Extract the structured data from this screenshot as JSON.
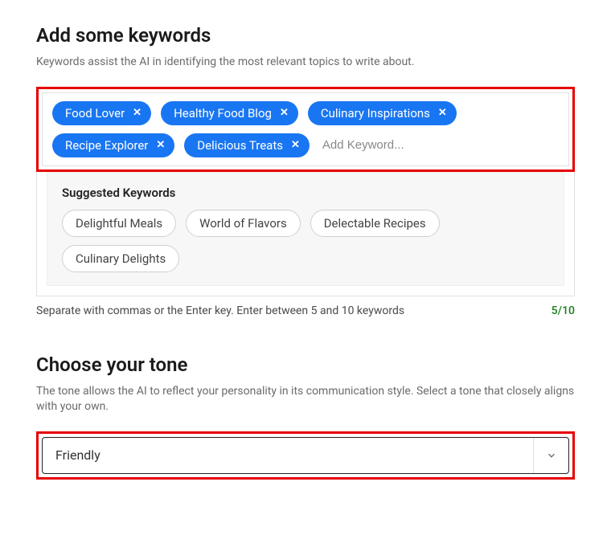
{
  "keywords": {
    "heading": "Add some keywords",
    "description": "Keywords assist the AI in identifying the most relevant topics to write about.",
    "tags": [
      {
        "label": "Food Lover"
      },
      {
        "label": "Healthy Food Blog"
      },
      {
        "label": "Culinary Inspirations"
      },
      {
        "label": "Recipe Explorer"
      },
      {
        "label": "Delicious Treats"
      }
    ],
    "input_placeholder": "Add Keyword...",
    "suggested_title": "Suggested Keywords",
    "suggested": [
      {
        "label": "Delightful Meals"
      },
      {
        "label": "World of Flavors"
      },
      {
        "label": "Delectable Recipes"
      },
      {
        "label": "Culinary Delights"
      }
    ],
    "helper_text": "Separate with commas or the Enter key. Enter between 5 and 10 keywords",
    "counter": "5/10"
  },
  "tone": {
    "heading": "Choose your tone",
    "description": "The tone allows the AI to reflect your personality in its communication style. Select a tone that closely aligns with your own.",
    "selected": "Friendly"
  }
}
